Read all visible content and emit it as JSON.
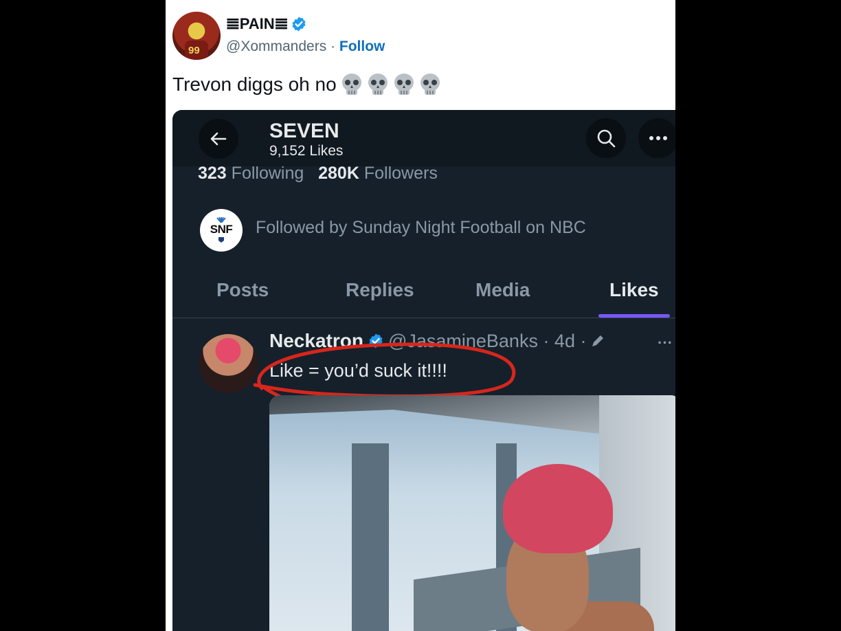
{
  "tweet": {
    "display_name": "𝌆PAIN𝌆",
    "handle": "@Xommanders",
    "separator": "·",
    "follow_label": "Follow",
    "avatar_number": "99",
    "text": "Trevon diggs oh no",
    "emoji_icons": [
      "skull-emoji",
      "skull-emoji",
      "skull-emoji",
      "skull-emoji"
    ]
  },
  "embedded_profile": {
    "name": "SEVEN",
    "likes_count": "9,152 Likes",
    "following_count": "323",
    "following_label": "Following",
    "followers_count": "280K",
    "followers_label": "Followers",
    "followed_by_badge": "SNF",
    "followed_by_text": "Followed by Sunday Night Football on NBC",
    "tabs": [
      {
        "label": "Posts",
        "active": false
      },
      {
        "label": "Replies",
        "active": false
      },
      {
        "label": "Media",
        "active": false
      },
      {
        "label": "Likes",
        "active": true
      }
    ],
    "liked_post": {
      "author": "Neckatron",
      "meta": "@JasamineBanks · 4d ·",
      "text": "Like = you’d suck it!!!!"
    }
  },
  "colors": {
    "verified_blue": "#1d9bf0",
    "follow_link": "#0f6fbd",
    "tab_accent": "#7856ff",
    "annotation_red": "#d8261b"
  }
}
